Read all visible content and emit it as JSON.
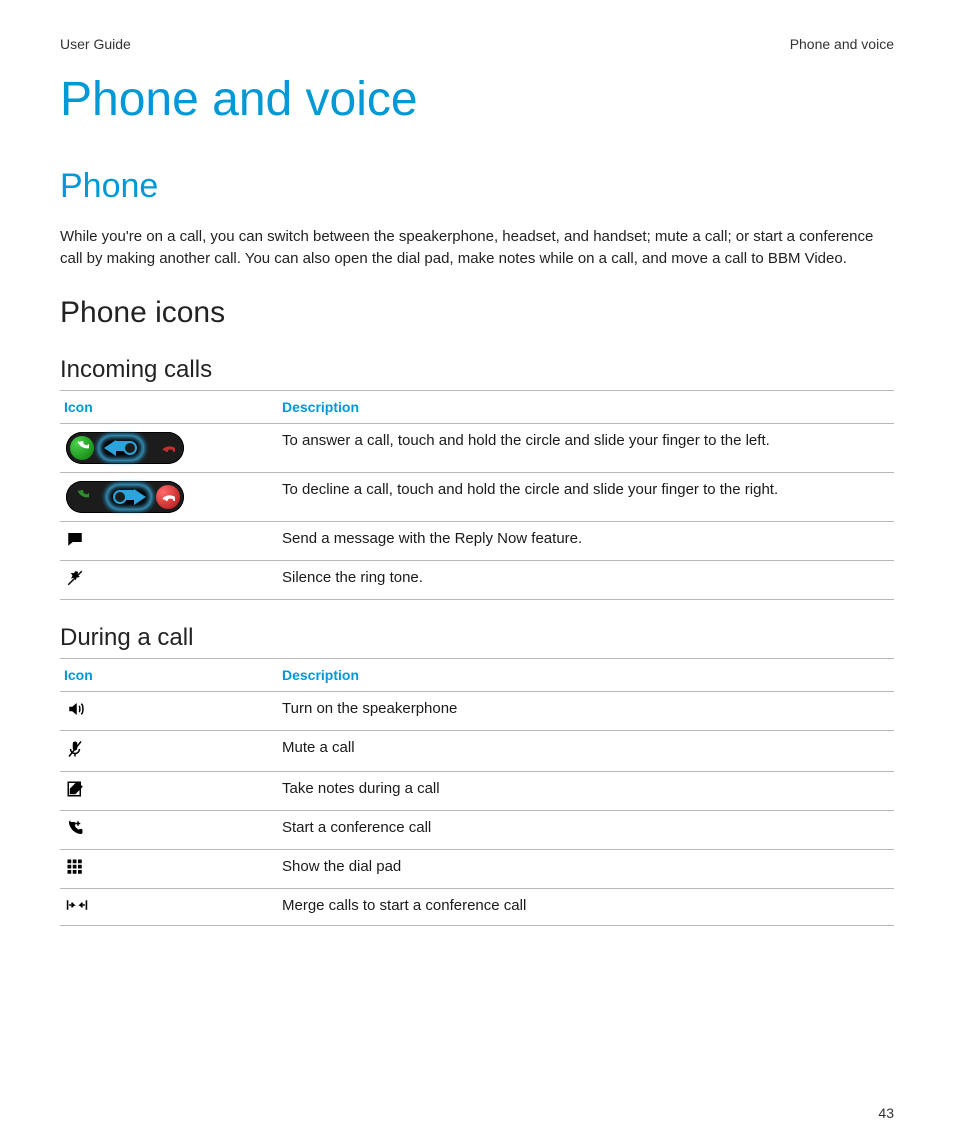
{
  "header": {
    "left": "User Guide",
    "right": "Phone and voice"
  },
  "title": "Phone and voice",
  "section": "Phone",
  "intro": "While you're on a call, you can switch between the speakerphone, headset, and handset; mute a call; or start a conference call by making another call. You can also open the dial pad, make notes while on a call, and move a call to BBM Video.",
  "phone_icons_heading": "Phone icons",
  "tables": {
    "col_icon": "Icon",
    "col_desc": "Description",
    "incoming": {
      "heading": "Incoming calls",
      "rows": [
        {
          "desc": "To answer a call, touch and hold the circle and slide your finger to the left."
        },
        {
          "desc": "To decline a call, touch and hold the circle and slide your finger to the right."
        },
        {
          "desc": "Send a message with the Reply Now feature."
        },
        {
          "desc": "Silence the ring tone."
        }
      ]
    },
    "during": {
      "heading": "During a call",
      "rows": [
        {
          "desc": "Turn on the speakerphone"
        },
        {
          "desc": "Mute a call"
        },
        {
          "desc": "Take notes during a call"
        },
        {
          "desc": "Start a conference call"
        },
        {
          "desc": "Show the dial pad"
        },
        {
          "desc": "Merge calls to start a conference call"
        }
      ]
    }
  },
  "page_number": "43"
}
